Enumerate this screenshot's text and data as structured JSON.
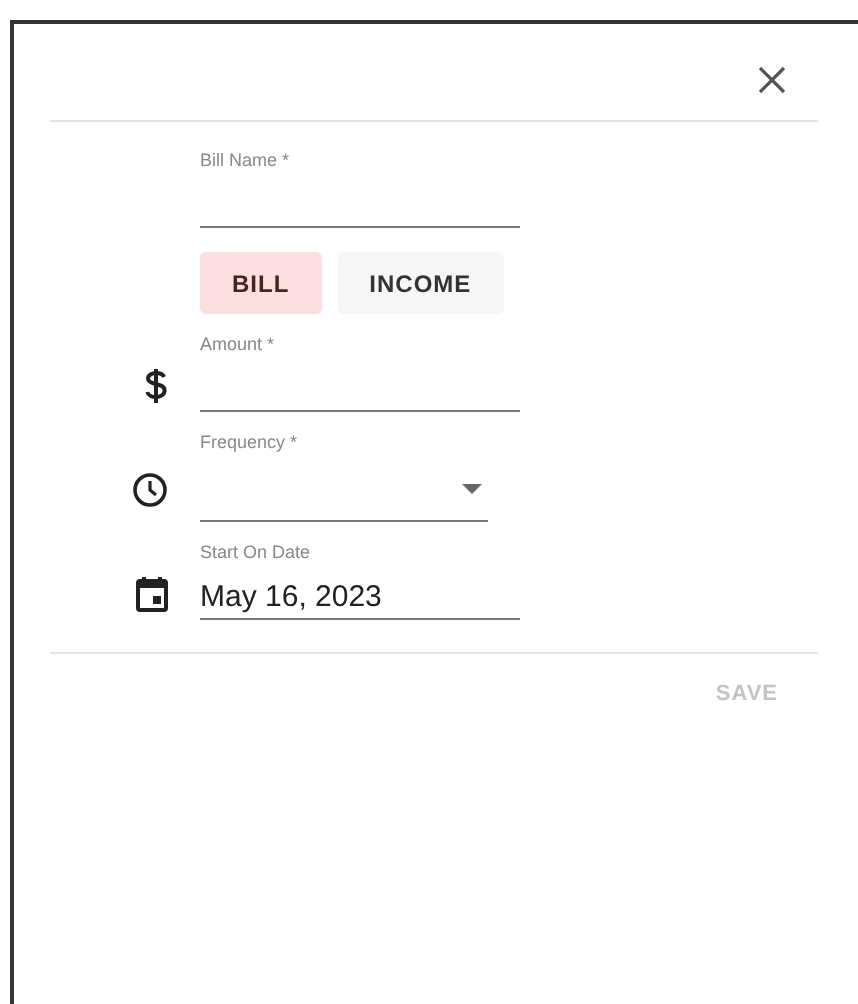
{
  "bill_name": {
    "label": "Bill Name *"
  },
  "type_toggle": [
    {
      "label": "BILL",
      "selected": true
    },
    {
      "label": "INCOME",
      "selected": false
    }
  ],
  "fields": [
    {
      "kind": "amount",
      "label": "Amount *"
    },
    {
      "kind": "frequency",
      "label": "Frequency *"
    },
    {
      "kind": "date",
      "label": "Start On Date",
      "value": "May 16, 2023"
    }
  ],
  "save_button": {
    "label": "SAVE",
    "disabled": true
  }
}
